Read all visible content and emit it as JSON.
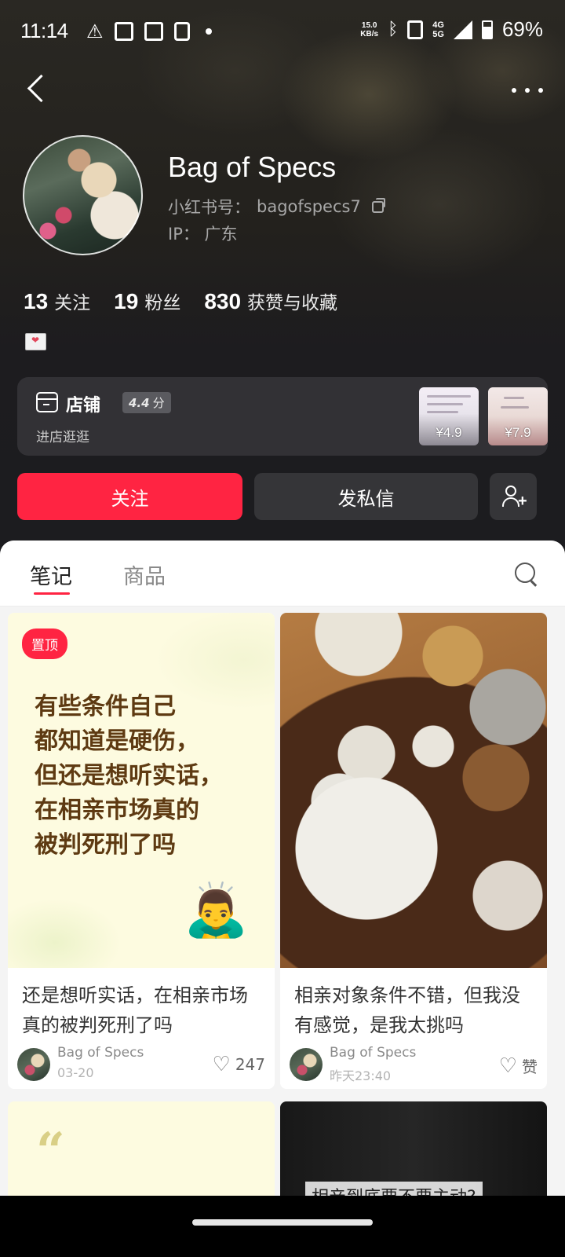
{
  "status_bar": {
    "time": "11:14",
    "net_speed_value": "15.0",
    "net_speed_unit": "KB/s",
    "network": [
      "4G",
      "5G"
    ],
    "battery": "69%",
    "battery_level": 0.69
  },
  "profile": {
    "username": "Bag of Specs",
    "id_label": "小红书号：",
    "id_value": "bagofspecs7",
    "ip_label": "IP：",
    "ip_value": "广东"
  },
  "stats": [
    {
      "number": "13",
      "label": "关注"
    },
    {
      "number": "19",
      "label": "粉丝"
    },
    {
      "number": "830",
      "label": "获赞与收藏"
    }
  ],
  "shop": {
    "title": "店铺",
    "score": "4.4",
    "score_unit": "分",
    "subtitle": "进店逛逛",
    "items": [
      {
        "price": "¥4.9"
      },
      {
        "price": "¥7.9"
      }
    ]
  },
  "actions": {
    "follow": "关注",
    "message": "发私信"
  },
  "tabs": [
    {
      "label": "笔记",
      "active": true
    },
    {
      "label": "商品",
      "active": false
    }
  ],
  "notes": [
    {
      "pin": "置顶",
      "cover_text": "有些条件自己\n都知道是硬伤，\n但还是想听实话，\n在相亲市场真的\n被判死刑了吗",
      "cover_emoji": "🙇‍♂️",
      "title": "还是想听实话，在相亲市场真的被判死刑了吗",
      "author": "Bag of Specs",
      "date": "03-20",
      "likes": "247"
    },
    {
      "title": "相亲对象条件不错，但我没有感觉，是我太挑吗",
      "author": "Bag of Specs",
      "date": "昨天23:40",
      "likes": "赞"
    },
    {
      "cover_text": "“"
    },
    {
      "cover_text": "相亲到底要不要主动?"
    }
  ],
  "colors": {
    "accent": "#ff2442",
    "header_bg": "#1c1c1f",
    "button_dark": "#353538"
  }
}
